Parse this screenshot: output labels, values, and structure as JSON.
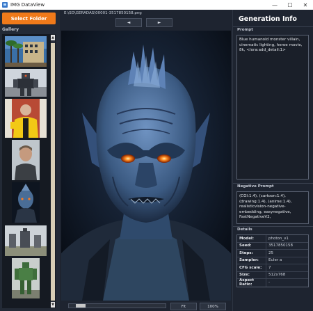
{
  "window": {
    "title": "IMG DataView",
    "minimize": "—",
    "maximize": "☐",
    "close": "✕"
  },
  "left": {
    "select_button": "Select Folder",
    "gallery_label": "Gallery",
    "thumbnails": [
      {
        "name": "thumb-1",
        "desc": "building-with-palm-trees"
      },
      {
        "name": "thumb-2",
        "desc": "robot-mech"
      },
      {
        "name": "thumb-3",
        "desc": "man-in-yellow-jacket"
      },
      {
        "name": "thumb-4",
        "desc": "man-portrait"
      },
      {
        "name": "thumb-5",
        "desc": "blue-monster-portrait"
      },
      {
        "name": "thumb-6",
        "desc": "mechs-in-field"
      },
      {
        "name": "thumb-7",
        "desc": "green-robot"
      }
    ]
  },
  "center": {
    "file_path": "E:\\SD\\GERADAS\\00001-3517850158.png",
    "prev": "◄",
    "next": "►",
    "fit": "Fit",
    "zoom": "100%"
  },
  "right": {
    "title": "Generation Info",
    "prompt_label": "Prompt",
    "prompt": "Blue humanoid monster villain, cinematic lighting, heroe movie, 8k, <lora:add_detail:1>",
    "negative_label": "Negative Prompt",
    "negative": "(CGI:1.4), (cartoon:1.4), (drawing:1.4), (anime:1.4), realisticvision-negative-embedding, easynegative, FastNegativeV2,",
    "details_label": "Details",
    "details": [
      {
        "key": "Model:",
        "value": "photon_v1"
      },
      {
        "key": "Seed:",
        "value": "3517850158"
      },
      {
        "key": "Steps:",
        "value": "25"
      },
      {
        "key": "Sampler:",
        "value": "Euler a"
      },
      {
        "key": "CFG scale:",
        "value": "7"
      },
      {
        "key": "Size:",
        "value": "512x768"
      },
      {
        "key": "Aspect Ratio:",
        "value": "-"
      }
    ]
  }
}
